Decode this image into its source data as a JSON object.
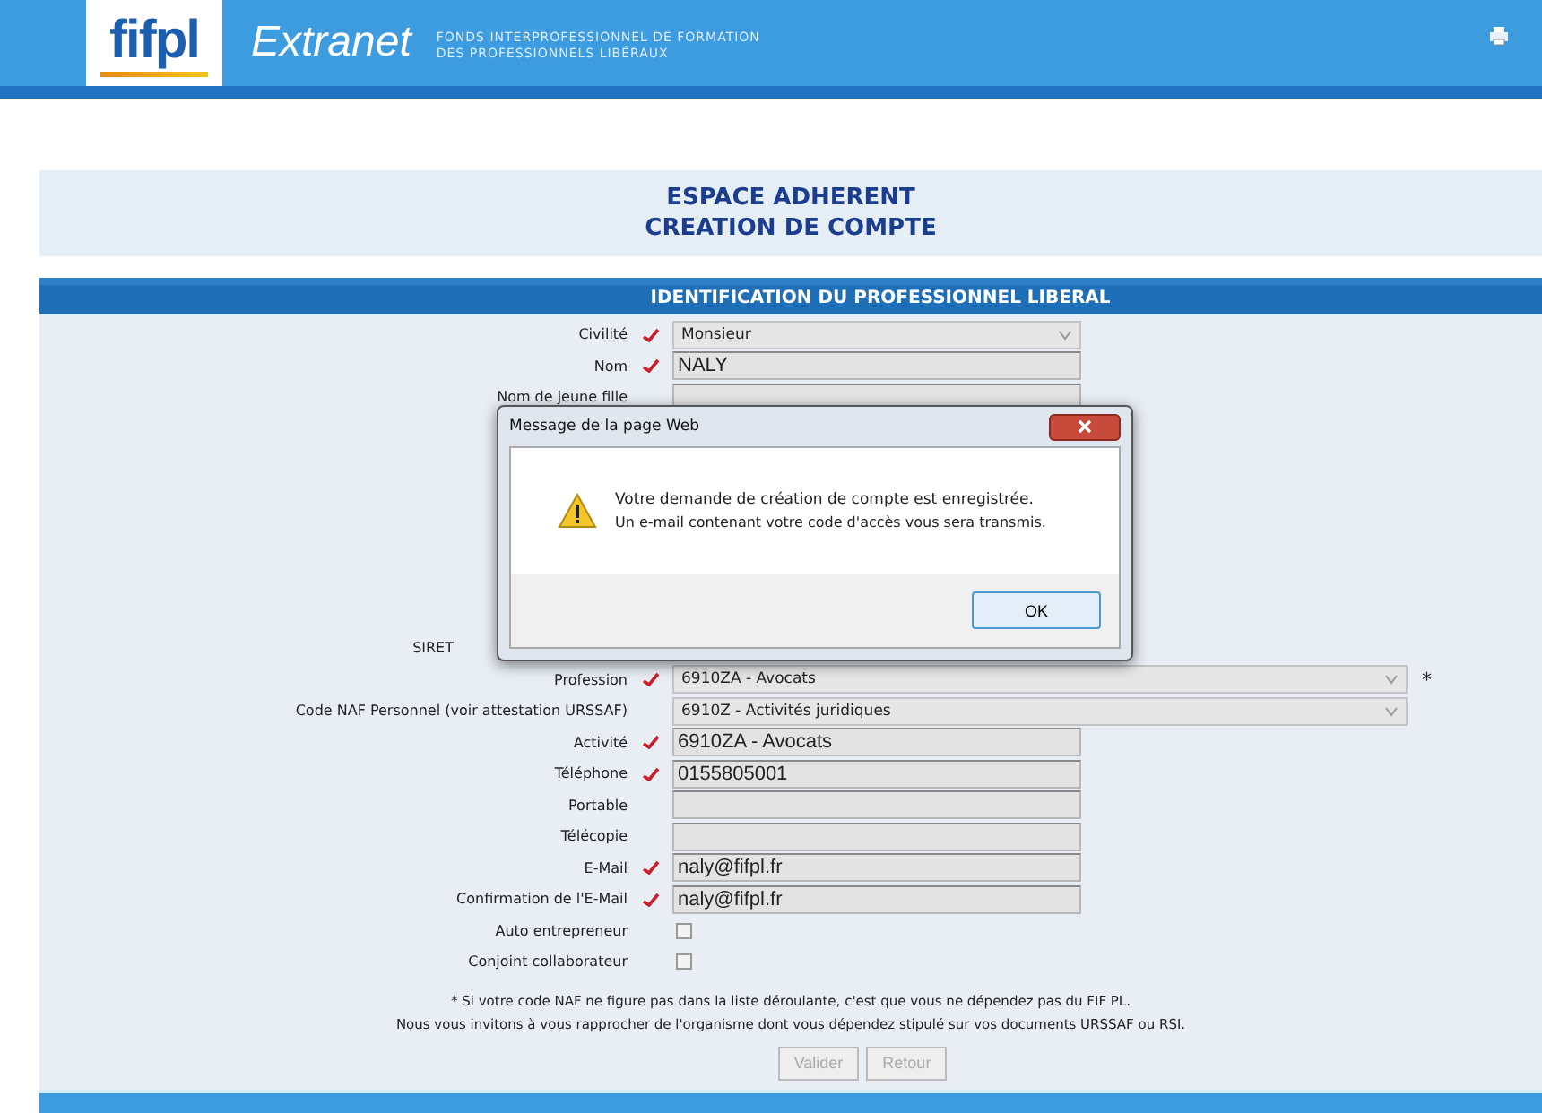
{
  "header": {
    "logo": "fifpl",
    "product": "Extranet",
    "tagline": [
      "FONDS INTERPROFESSIONNEL DE FORMATION",
      "DES PROFESSIONNELS LIBÉRAUX"
    ]
  },
  "title": [
    "ESPACE ADHERENT",
    "CREATION DE COMPTE"
  ],
  "section": "IDENTIFICATION DU PROFESSIONNEL LIBERAL",
  "fields_top": [
    {
      "label": "Civilité",
      "required": true,
      "kind": "select",
      "value": "Monsieur"
    },
    {
      "label": "Nom",
      "required": true,
      "kind": "text",
      "value": "NALY"
    },
    {
      "label": "Nom de jeune fille",
      "required": false,
      "kind": "text"
    }
  ],
  "covered_label": "SIRET",
  "fields_bottom": [
    {
      "label": "Profession",
      "required": true,
      "kind": "wideselect",
      "value": "6910ZA - Avocats",
      "note": "*"
    },
    {
      "label": "Code NAF Personnel (voir attestation URSSAF)",
      "required": false,
      "kind": "wideselect",
      "value": "6910Z - Activités juridiques"
    },
    {
      "label": "Activité",
      "required": true,
      "kind": "text",
      "value": "6910ZA - Avocats"
    },
    {
      "label": "Téléphone",
      "required": true,
      "kind": "text",
      "value": "0155805001"
    },
    {
      "label": "Portable",
      "required": false,
      "kind": "text"
    },
    {
      "label": "Télécopie",
      "required": false,
      "kind": "text"
    },
    {
      "label": "E-Mail",
      "required": true,
      "kind": "text",
      "value": "naly@fifpl.fr"
    },
    {
      "label": "Confirmation de l'E-Mail",
      "required": true,
      "kind": "text",
      "value": "naly@fifpl.fr"
    },
    {
      "label": "Auto entrepreneur",
      "required": false,
      "kind": "checkbox",
      "checked": false
    },
    {
      "label": "Conjoint collaborateur",
      "required": false,
      "kind": "checkbox",
      "checked": false
    }
  ],
  "notes": [
    "* Si votre code NAF ne figure pas dans la liste déroulante, c'est que vous ne dépendez pas du FIF PL.",
    "Nous vous invitons à vous rapprocher de l'organisme dont vous dépendez stipulé sur vos documents URSSAF ou RSI."
  ],
  "buttons": [
    {
      "label": "Valider",
      "disabled": true
    },
    {
      "label": "Retour",
      "disabled": true
    }
  ],
  "dialog": {
    "title": "Message de la page Web",
    "lines": [
      "Votre demande de création de compte est enregistrée.",
      "Un e-mail contenant votre code d'accès vous sera transmis."
    ],
    "button": "OK"
  }
}
